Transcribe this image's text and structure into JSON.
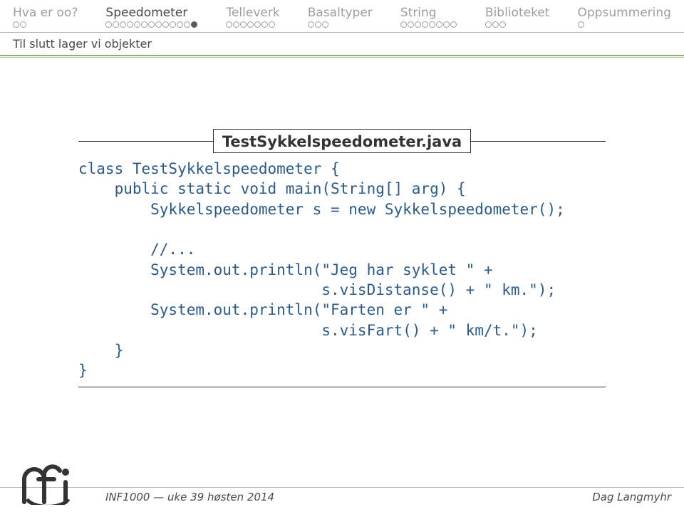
{
  "nav": [
    {
      "label": "Hva er oo?",
      "active": false,
      "dots": 2,
      "current": 0
    },
    {
      "label": "Speedometer",
      "active": true,
      "dots": 13,
      "current": 13
    },
    {
      "label": "Telleverk",
      "active": false,
      "dots": 7,
      "current": 0
    },
    {
      "label": "Basaltyper",
      "active": false,
      "dots": 3,
      "current": 0
    },
    {
      "label": "String",
      "active": false,
      "dots": 8,
      "current": 0
    },
    {
      "label": "Biblioteket",
      "active": false,
      "dots": 3,
      "current": 0
    },
    {
      "label": "Oppsummering",
      "active": false,
      "dots": 1,
      "current": 0
    }
  ],
  "subtitle": "Til slutt lager vi objekter",
  "code_title": "TestSykkelspeedometer.java",
  "code": "class TestSykkelspeedometer {\n    public static void main(String[] arg) {\n        Sykkelspeedometer s = new Sykkelspeedometer();\n\n        //...\n        System.out.println(\"Jeg har syklet \" +\n                           s.visDistanse() + \" km.\");\n        System.out.println(\"Farten er \" +\n                           s.visFart() + \" km/t.\");\n    }\n}",
  "footer": {
    "left": "INF1000 — uke 39 høsten 2014",
    "right": "Dag Langmyhr"
  }
}
